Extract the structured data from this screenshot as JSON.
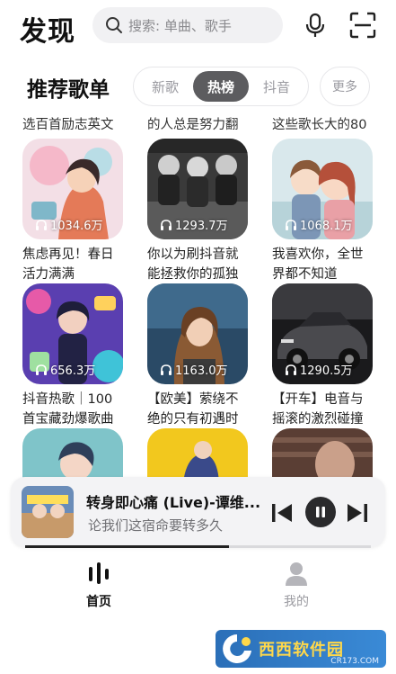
{
  "header": {
    "title": "发现",
    "search_placeholder": "搜索: 单曲、歌手",
    "icons": [
      "search-icon",
      "microphone-icon",
      "scan-icon"
    ]
  },
  "section": {
    "title": "推荐歌单",
    "tabs": [
      {
        "label": "新歌",
        "active": false
      },
      {
        "label": "热榜",
        "active": true
      },
      {
        "label": "抖音",
        "active": false
      }
    ],
    "more_label": "更多"
  },
  "top_captions": [
    "选百首励志英文",
    "的人总是努力翻",
    "这些歌长大的80"
  ],
  "playlists": [
    {
      "plays": "1034.6万",
      "title": "焦虑再见！春日活力满满"
    },
    {
      "plays": "1293.7万",
      "title": "你以为刷抖音就能拯救你的孤独"
    },
    {
      "plays": "1068.1万",
      "title": "我喜欢你，全世界都不知道"
    },
    {
      "plays": "656.3万",
      "title": "抖音热歌｜100首宝藏劲爆歌曲"
    },
    {
      "plays": "1163.0万",
      "title": "【欧美】萦绕不绝的只有初遇时"
    },
    {
      "plays": "1290.5万",
      "title": "【开车】电音与摇滚的激烈碰撞"
    }
  ],
  "player": {
    "title": "转身即心痛 (Live)-谭维...",
    "lyric": "论我们这宿命要转多久",
    "progress": 0.59,
    "controls": [
      "previous-icon",
      "pause-icon",
      "next-icon"
    ]
  },
  "nav": {
    "home_label": "首页",
    "me_label": "我的",
    "active": "home"
  },
  "watermark": {
    "text": "西西软件园",
    "url": "CR173.COM"
  },
  "colors": {
    "accent": "#5c5c5f",
    "background": "#ffffff",
    "player_bg": "#f3f3f5",
    "watermark_bg": "#2b6fb8"
  }
}
